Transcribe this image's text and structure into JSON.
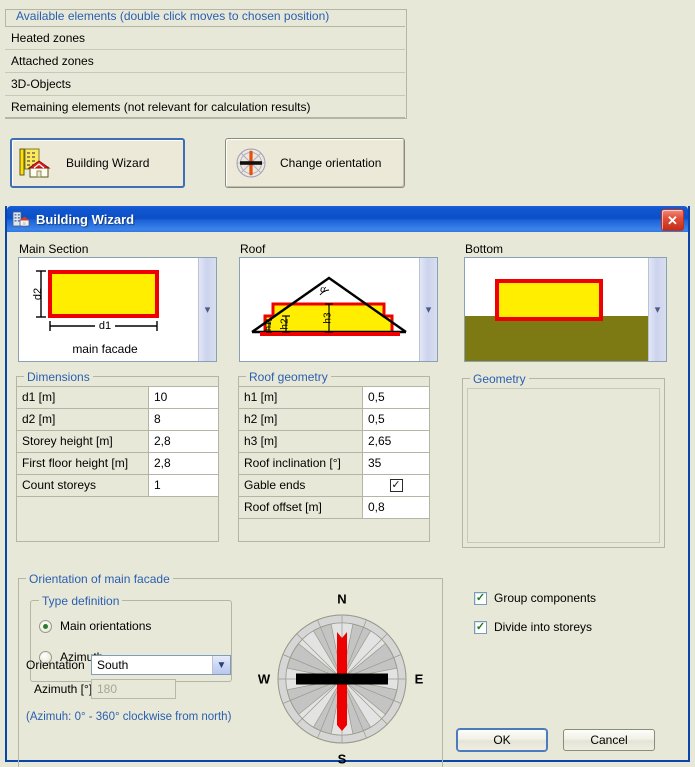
{
  "background": {
    "available_group": {
      "legend": "Available elements (double click moves to chosen position)",
      "rows": [
        "Heated zones",
        "Attached zones",
        "3D-Objects",
        "Remaining elements (not relevant for calculation results)"
      ]
    },
    "buttons": [
      {
        "label": "Building Wizard",
        "icon": "building-wizard-icon"
      },
      {
        "label": "Change orientation",
        "icon": "compass-icon"
      }
    ]
  },
  "dialog": {
    "title": "Building Wizard",
    "title_icon": "building-icon",
    "close_label": "✕",
    "panels": [
      {
        "label": "Main Section",
        "caption": "main facade",
        "dim_v": "d2",
        "dim_h": "d1"
      },
      {
        "label": "Roof",
        "h1": "h1",
        "h2": "h2",
        "h3": "h3",
        "angle": "α"
      },
      {
        "label": "Bottom"
      }
    ],
    "dimensions": {
      "legend": "Dimensions",
      "rows": [
        {
          "key": "d1  [m]",
          "value": "10"
        },
        {
          "key": "d2  [m]",
          "value": "8"
        },
        {
          "key": "Storey height  [m]",
          "value": "2,8"
        },
        {
          "key": "First floor height  [m]",
          "value": "2,8"
        },
        {
          "key": "Count storeys",
          "value": "1"
        }
      ]
    },
    "roof_geometry": {
      "legend": "Roof geometry",
      "rows": [
        {
          "key": "h1  [m]",
          "value": "0,5",
          "type": "text"
        },
        {
          "key": "h2  [m]",
          "value": "0,5",
          "type": "text"
        },
        {
          "key": "h3  [m]",
          "value": "2,65",
          "type": "text"
        },
        {
          "key": "Roof inclination  [°]",
          "value": "35",
          "type": "text"
        },
        {
          "key": "Gable ends",
          "value": "",
          "type": "checkbox",
          "checked": true
        },
        {
          "key": "Roof offset  [m]",
          "value": "0,8",
          "type": "text"
        }
      ]
    },
    "geometry": {
      "legend": "Geometry"
    },
    "orientation": {
      "legend": "Orientation of main facade",
      "type_definition": {
        "legend": "Type definition",
        "options": [
          {
            "label": "Main orientations",
            "selected": true
          },
          {
            "label": "Azimuth",
            "selected": false
          }
        ]
      },
      "orientation_label": "Orientation",
      "orientation_value": "South",
      "azimuth_label": "Azimuth [°]",
      "azimuth_value": "180",
      "hint": "(Azimuh: 0° - 360° clockwise from north)",
      "compass": {
        "n": "N",
        "e": "E",
        "s": "S",
        "w": "W"
      }
    },
    "options": [
      {
        "label": "Group components",
        "checked": true
      },
      {
        "label": "Divide into storeys",
        "checked": true
      }
    ],
    "actions": [
      {
        "label": "OK",
        "default": true
      },
      {
        "label": "Cancel",
        "default": false
      }
    ]
  },
  "colors": {
    "window_bg": "#e8e8d8",
    "title_blue": "#0b4fc8",
    "legend_blue": "#2a5fb0",
    "wall_yellow": "#ffee00",
    "wall_red": "#ee0000",
    "ground_olive": "#7d7a14",
    "compass_red": "#ee0000"
  }
}
